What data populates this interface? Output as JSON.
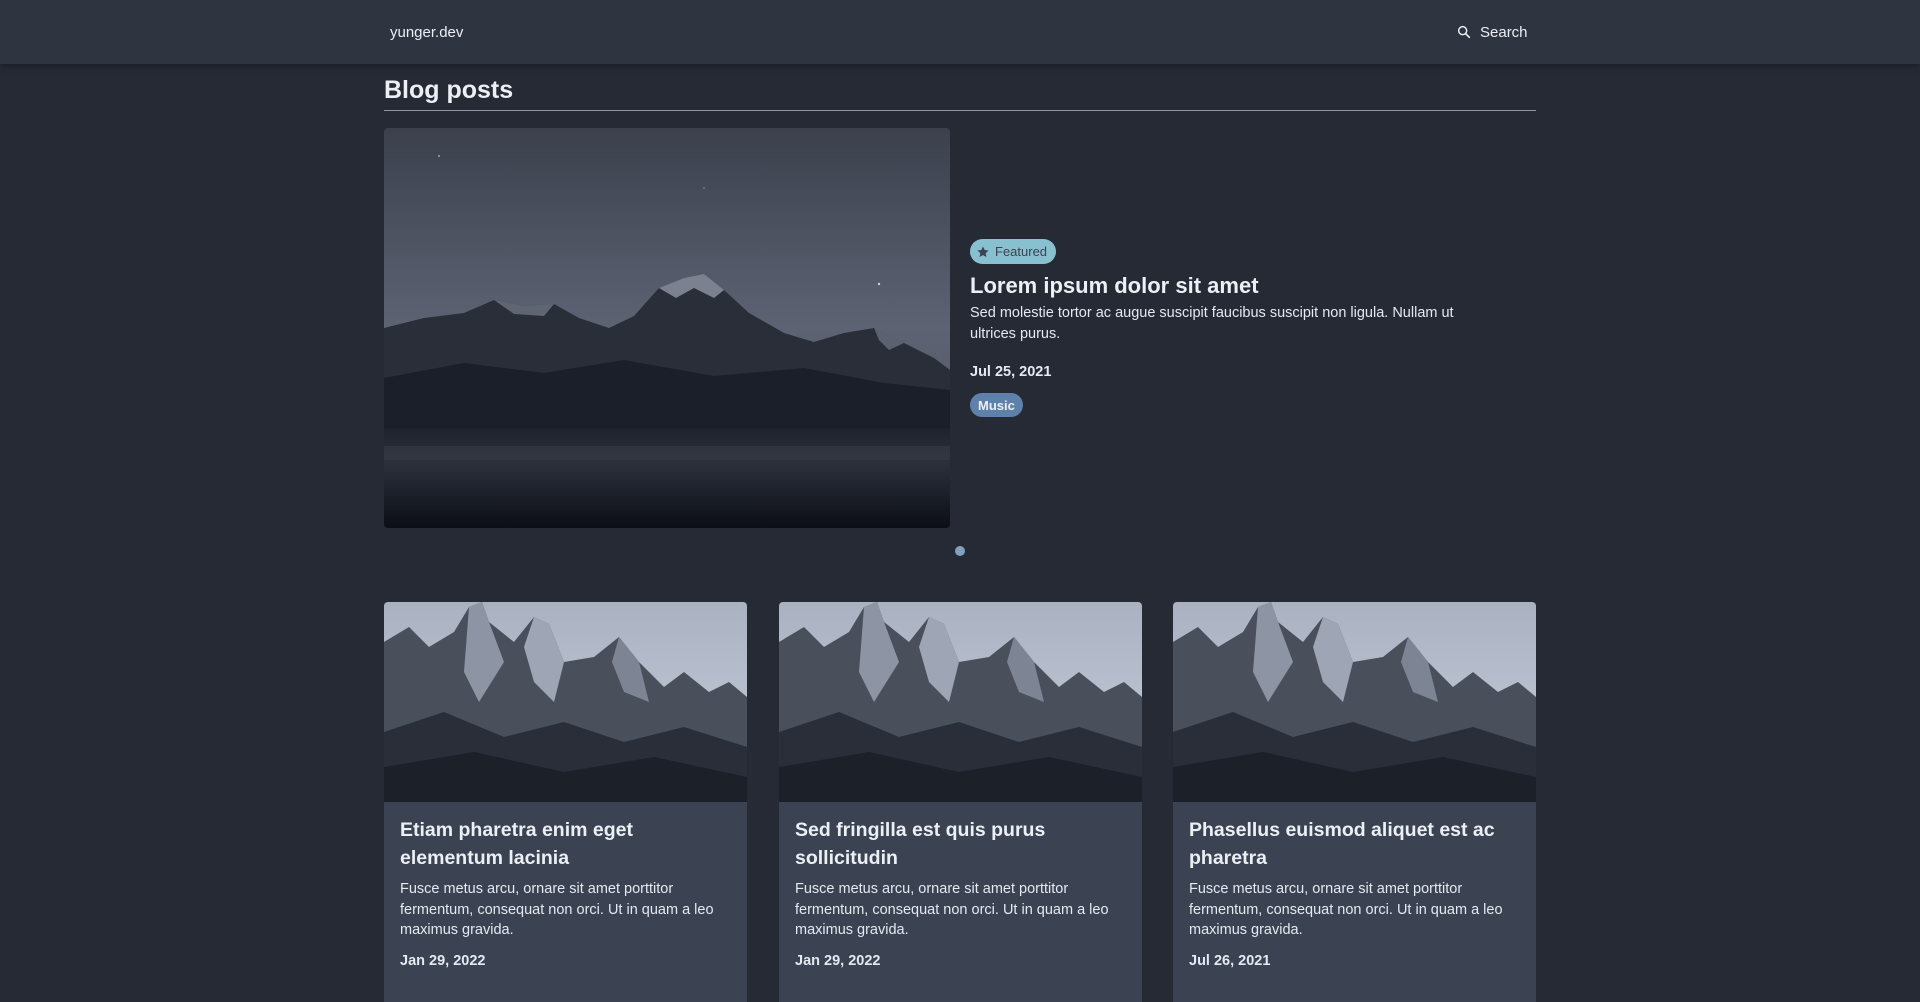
{
  "header": {
    "brand": "yunger.dev",
    "search_label": "Search",
    "search_icon": "search-icon"
  },
  "main": {
    "heading": "Blog posts",
    "featured": {
      "badge": "Featured",
      "badge_icon": "star-icon",
      "title_prefix": "Lorem ipsum dolor sit",
      "title_emphasis": "amet",
      "description": "Sed molestie tortor ac augue suscipit faucibus suscipit non ligula. Nullam ut ultrices purus.",
      "date": "Jul 25, 2021",
      "tag": "Music",
      "image": "mountain-night-image"
    },
    "carousel": {
      "slides": 1,
      "active": 1
    },
    "posts": [
      {
        "title": "Etiam pharetra enim eget elementum lacinia",
        "description": "Fusce metus arcu, ornare sit amet porttitor fermentum, consequat non orci. Ut in quam a leo maximus gravida.",
        "date": "Jan 29, 2022",
        "image": "mountain-peaks-image"
      },
      {
        "title": "Sed fringilla est quis purus sollicitudin",
        "description": "Fusce metus arcu, ornare sit amet porttitor fermentum, consequat non orci. Ut in quam a leo maximus gravida.",
        "date": "Jan 29, 2022",
        "image": "mountain-peaks-image"
      },
      {
        "title": "Phasellus euismod aliquet est ac pharetra",
        "description": "Fusce metus arcu, ornare sit amet porttitor fermentum, consequat non orci. Ut in quam a leo maximus gravida.",
        "date": "Jul 26, 2021",
        "image": "mountain-peaks-image"
      }
    ]
  },
  "colors": {
    "background": "#252a35",
    "header": "#2f3441",
    "card": "#3b4252",
    "featured_badge": "#88c0d0",
    "tag": "#5e81ac",
    "dot": "#81a1c1",
    "text": "#eceff4"
  }
}
